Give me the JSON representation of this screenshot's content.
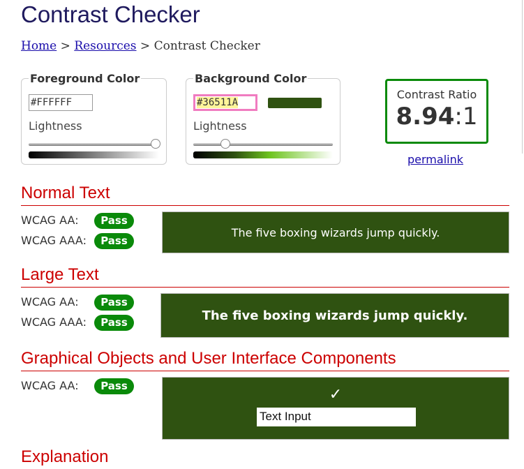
{
  "title": "Contrast Checker",
  "breadcrumb": {
    "home": "Home",
    "sep1": ">",
    "resources": "Resources",
    "sep2": ">",
    "current": "Contrast Checker"
  },
  "foreground": {
    "legend": "Foreground Color",
    "value": "#FFFFFF",
    "lightness_label": "Lightness",
    "lightness": 1.0
  },
  "background": {
    "legend": "Background Color",
    "value": "#36511A",
    "lightness_label": "Lightness",
    "lightness": 0.21,
    "swatch": "#2f5211"
  },
  "contrast": {
    "label": "Contrast Ratio",
    "value": "8.94",
    "suffix": ":1",
    "permalink": "permalink"
  },
  "sections": {
    "normal": {
      "heading": "Normal Text",
      "aa": "WCAG AA:",
      "aaa": "WCAG AAA:",
      "aa_result": "Pass",
      "aaa_result": "Pass",
      "sample": "The five boxing wizards jump quickly."
    },
    "large": {
      "heading": "Large Text",
      "aa": "WCAG AA:",
      "aaa": "WCAG AAA:",
      "aa_result": "Pass",
      "aaa_result": "Pass",
      "sample": "The five boxing wizards jump quickly."
    },
    "graphical": {
      "heading": "Graphical Objects and User Interface Components",
      "aa": "WCAG AA:",
      "aa_result": "Pass",
      "check": "✓",
      "input_value": "Text Input"
    },
    "explanation": {
      "heading": "Explanation"
    }
  },
  "colors": {
    "pass": "#0a8a0a",
    "heading": "#cc0000",
    "sample_bg": "#2f5211"
  }
}
